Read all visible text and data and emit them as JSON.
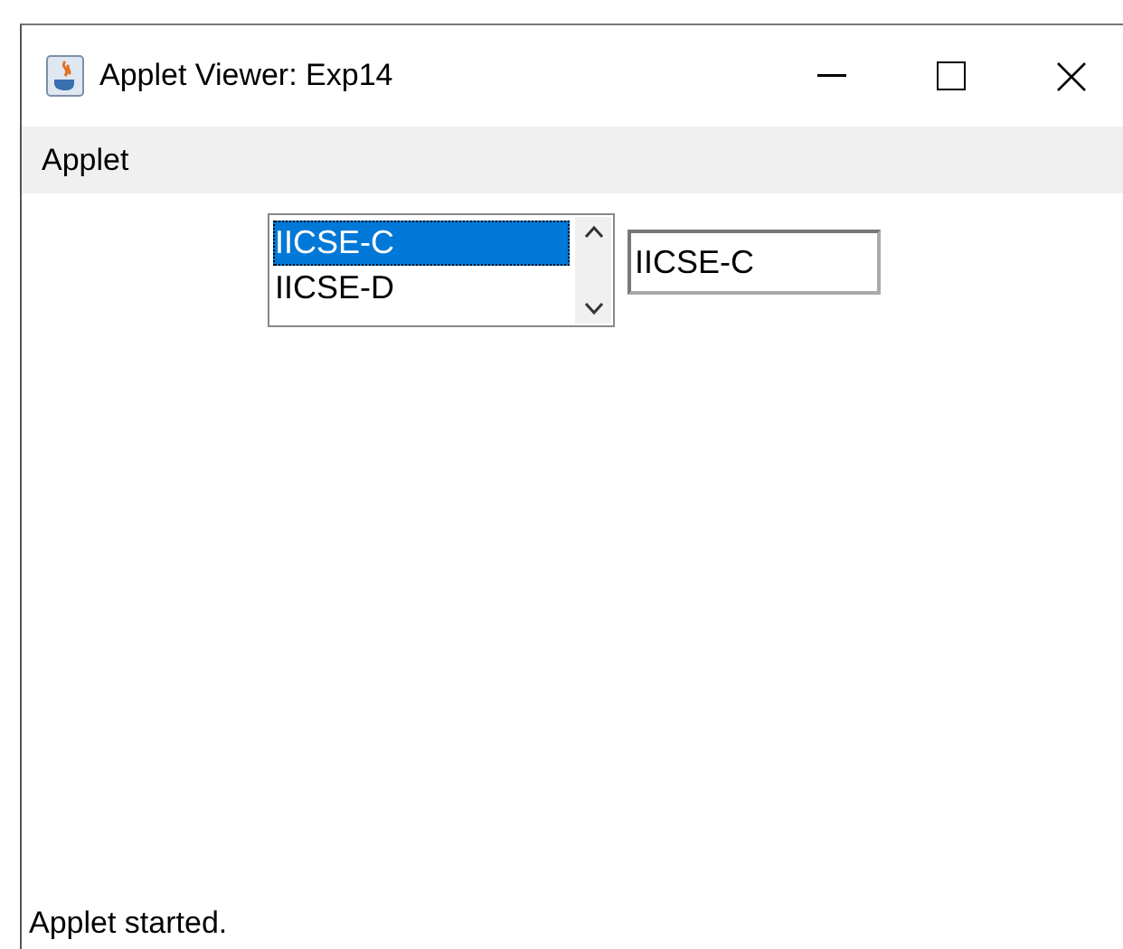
{
  "window": {
    "title": "Applet Viewer: Exp14"
  },
  "menu": [
    "Applet"
  ],
  "list": {
    "items": [
      {
        "label": "IICSE-C",
        "selected": true
      },
      {
        "label": "IICSE-D",
        "selected": false
      }
    ]
  },
  "text_field": {
    "value": "IICSE-C"
  },
  "status_bar": "Applet started."
}
